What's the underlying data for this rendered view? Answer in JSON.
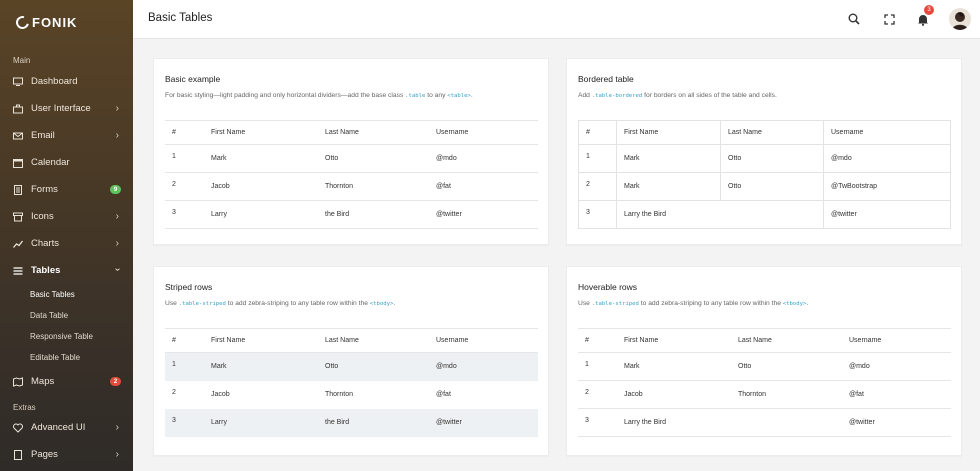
{
  "brand": {
    "name": "FONIK"
  },
  "sidebar": {
    "section_main": "Main",
    "section_extras": "Extras",
    "items": [
      {
        "label": "Dashboard",
        "icon": "monitor-icon"
      },
      {
        "label": "User Interface",
        "icon": "briefcase-icon"
      },
      {
        "label": "Email",
        "icon": "mail-icon"
      },
      {
        "label": "Calendar",
        "icon": "calendar-icon"
      },
      {
        "label": "Forms",
        "icon": "document-icon",
        "badge": "9"
      },
      {
        "label": "Icons",
        "icon": "archive-icon"
      },
      {
        "label": "Charts",
        "icon": "line-chart-icon"
      },
      {
        "label": "Tables",
        "icon": "list-icon"
      },
      {
        "label": "Maps",
        "icon": "map-icon",
        "badge": "2"
      },
      {
        "label": "Advanced UI",
        "icon": "heart-icon"
      },
      {
        "label": "Pages",
        "icon": "page-icon"
      }
    ],
    "tables_sub": [
      "Basic Tables",
      "Data Table",
      "Responsive Table",
      "Editable Table"
    ]
  },
  "header": {
    "title": "Basic Tables",
    "notif_count": "3"
  },
  "colors": {
    "accent_green": "#5cc460",
    "badge_red": "#e54b3c",
    "code_blue": "#3aa0c5"
  },
  "cards": {
    "basic": {
      "title": "Basic example",
      "desc_pre": "For basic styling—light padding and only horizontal dividers—add the base class ",
      "desc_code1": ".table",
      "desc_mid": " to any ",
      "desc_code2": "<table>",
      "desc_post": ".",
      "headers": [
        "#",
        "First Name",
        "Last Name",
        "Username"
      ],
      "rows": [
        [
          "1",
          "Mark",
          "Otto",
          "@mdo"
        ],
        [
          "2",
          "Jacob",
          "Thornton",
          "@fat"
        ],
        [
          "3",
          "Larry",
          "the Bird",
          "@twitter"
        ]
      ]
    },
    "bordered": {
      "title": "Bordered table",
      "desc_pre": "Add ",
      "desc_code1": ".table-bordered",
      "desc_post": " for borders on all sides of the table and cells.",
      "headers": [
        "#",
        "First Name",
        "Last Name",
        "Username"
      ],
      "rows": [
        [
          "1",
          "Mark",
          "Otto",
          "@mdo"
        ],
        [
          "2",
          "Mark",
          "Otto",
          "@TwBootstrap"
        ],
        [
          "3",
          "Larry the Bird",
          "",
          "@twitter"
        ]
      ]
    },
    "striped": {
      "title": "Striped rows",
      "desc_pre": "Use ",
      "desc_code1": ".table-striped",
      "desc_mid": " to add zebra-striping to any table row within the ",
      "desc_code2": "<tbody>",
      "desc_post": ".",
      "headers": [
        "#",
        "First Name",
        "Last Name",
        "Username"
      ],
      "rows": [
        [
          "1",
          "Mark",
          "Otto",
          "@mdo"
        ],
        [
          "2",
          "Jacob",
          "Thornton",
          "@fat"
        ],
        [
          "3",
          "Larry",
          "the Bird",
          "@twitter"
        ]
      ]
    },
    "hoverable": {
      "title": "Hoverable rows",
      "desc_pre": "Use ",
      "desc_code1": ".table-striped",
      "desc_mid": " to add zebra-striping to any table row within the ",
      "desc_code2": "<tbody>",
      "desc_post": ".",
      "headers": [
        "#",
        "First Name",
        "Last Name",
        "Username"
      ],
      "rows": [
        [
          "1",
          "Mark",
          "Otto",
          "@mdo"
        ],
        [
          "2",
          "Jacob",
          "Thornton",
          "@fat"
        ],
        [
          "3",
          "Larry the Bird",
          "",
          "@twitter"
        ]
      ]
    }
  }
}
